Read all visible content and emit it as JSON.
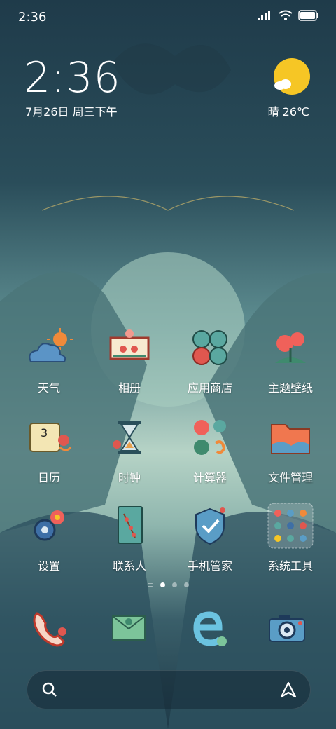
{
  "status_bar": {
    "time": "2:36"
  },
  "clock": {
    "time": "2:36",
    "date": "7月26日 周三下午"
  },
  "weather": {
    "text": "晴 26℃"
  },
  "apps": [
    {
      "label": "天气",
      "icon": "weather-icon"
    },
    {
      "label": "相册",
      "icon": "gallery-icon"
    },
    {
      "label": "应用商店",
      "icon": "app-store-icon"
    },
    {
      "label": "主题壁纸",
      "icon": "themes-icon"
    },
    {
      "label": "日历",
      "icon": "calendar-icon"
    },
    {
      "label": "时钟",
      "icon": "clock-icon"
    },
    {
      "label": "计算器",
      "icon": "calculator-icon"
    },
    {
      "label": "文件管理",
      "icon": "file-manager-icon"
    },
    {
      "label": "设置",
      "icon": "settings-icon"
    },
    {
      "label": "联系人",
      "icon": "contacts-icon"
    },
    {
      "label": "手机管家",
      "icon": "security-icon"
    },
    {
      "label": "系统工具",
      "icon": "system-tools-folder-icon"
    }
  ],
  "calendar_icon_day": "3",
  "dock": [
    {
      "icon": "phone-icon"
    },
    {
      "icon": "messages-icon"
    },
    {
      "icon": "browser-icon"
    },
    {
      "icon": "camera-icon"
    }
  ],
  "pages": {
    "count": 3,
    "current": 1
  },
  "colors": {
    "accent_red": "#e0574f",
    "teal": "#5aa8a0",
    "sun": "#f6c625"
  }
}
